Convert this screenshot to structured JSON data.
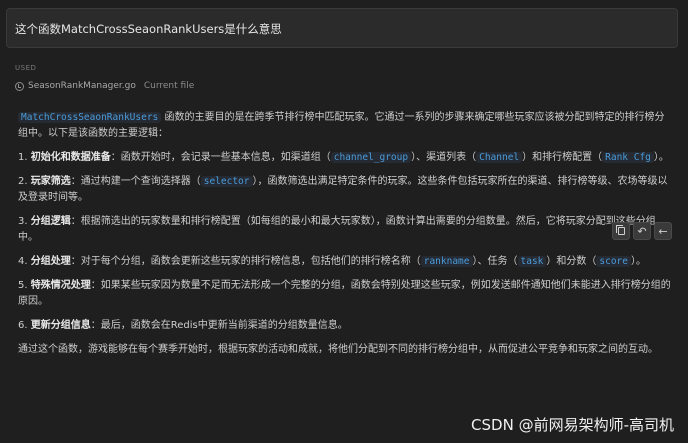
{
  "question": {
    "text": "这个函数MatchCrossSeaonRankUsers是什么意思"
  },
  "context": {
    "used_label": "USED",
    "file_name": "SeasonRankManager.go",
    "file_status": "Current file"
  },
  "answer": {
    "intro": {
      "code": "MatchCrossSeaonRankUsers",
      "text": " 函数的主要目的是在跨季节排行榜中匹配玩家。它通过一系列的步骤来确定哪些玩家应该被分配到特定的排行榜分组中。以下是该函数的主要逻辑："
    },
    "items": [
      {
        "num": "1.",
        "title": "初始化和数据准备",
        "text1": "：函数开始时，会记录一些基本信息，如渠道组（",
        "code1": "channel_group",
        "text2": "）、渠道列表（",
        "code2": "Channel",
        "text3": "）和排行榜配置（",
        "code3": "Rank Cfg",
        "text4": "）。"
      },
      {
        "num": "2.",
        "title": "玩家筛选",
        "text1": "：通过构建一个查询选择器（",
        "code1": "selector",
        "text2": "），函数筛选出满足特定条件的玩家。这些条件包括玩家所在的渠道、排行榜等级、农场等级以及登录时间等。"
      },
      {
        "num": "3.",
        "title": "分组逻辑",
        "text1": "：根据筛选出的玩家数量和排行榜配置（如每组的最小和最大玩家数），函数计算出需要的分组数量。然后，它将玩家分配到这些分组中。"
      },
      {
        "num": "4.",
        "title": "分组处理",
        "text1": "：对于每个分组，函数会更新这些玩家的排行榜信息，包括他们的排行榜名称（",
        "code1": "rankname",
        "text2": "）、任务（",
        "code2": "task",
        "text3": "）和分数（",
        "code3": "score",
        "text4": "）。"
      },
      {
        "num": "5.",
        "title": "特殊情况处理",
        "text1": "：如果某些玩家因为数量不足而无法形成一个完整的分组，函数会特别处理这些玩家，例如发送邮件通知他们未能进入排行榜分组的原因。"
      },
      {
        "num": "6.",
        "title": "更新分组信息",
        "text1": "：最后，函数会在Redis中更新当前渠道的分组数量信息。"
      }
    ],
    "conclusion": "通过这个函数，游戏能够在每个赛季开始时，根据玩家的活动和成就，将他们分配到不同的排行榜分组中，从而促进公平竞争和玩家之间的互动。"
  },
  "toolbar": {
    "copy_icon": "copy-icon",
    "insert_glyph": "↶",
    "back_glyph": "←"
  },
  "watermark": "CSDN @前网易架构师-高司机"
}
